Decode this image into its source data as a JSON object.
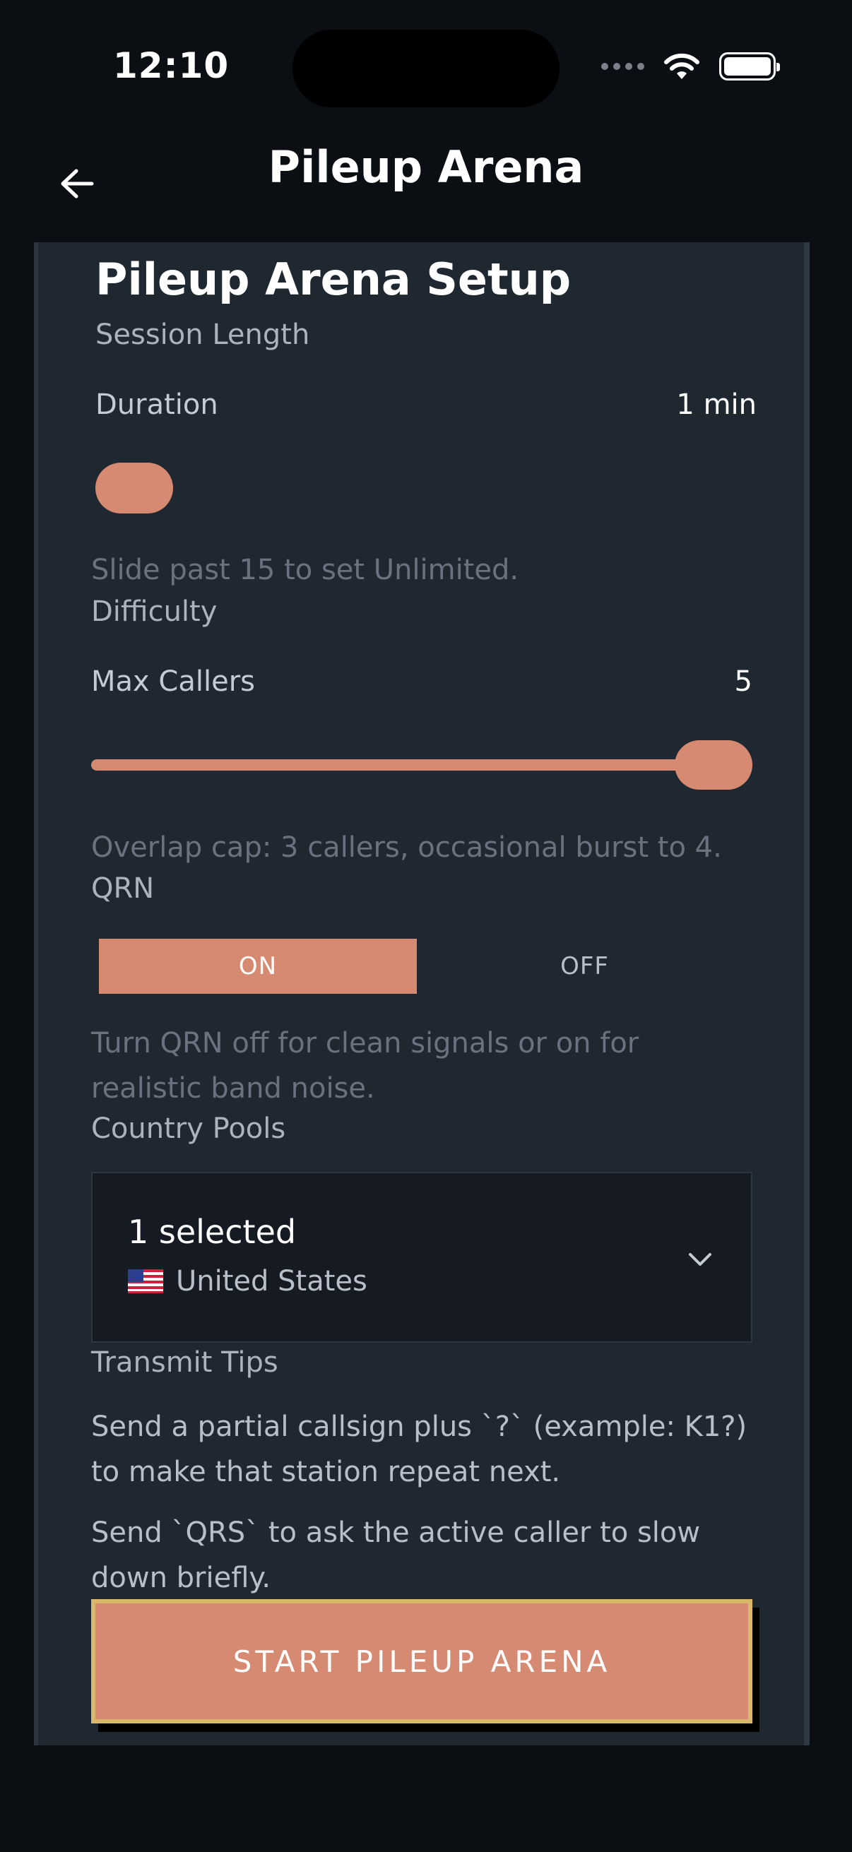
{
  "status": {
    "time": "12:10"
  },
  "app": {
    "title": "Pileup Arena"
  },
  "setup": {
    "heading": "Pileup Arena Setup",
    "session_length": {
      "section": "Session Length",
      "label": "Duration",
      "value": "1 min",
      "slider_fraction": 0.0,
      "hint": "Slide past 15 to set Unlimited."
    },
    "difficulty": {
      "section": "Difficulty",
      "label": "Max Callers",
      "value": "5",
      "slider_fraction": 1.0,
      "hint": "Overlap cap: 3 callers, occasional burst to 4."
    },
    "qrn": {
      "section": "QRN",
      "on_label": "ON",
      "off_label": "OFF",
      "selected": "ON",
      "hint": "Turn QRN off for clean signals or on for realistic band noise."
    },
    "country_pools": {
      "section": "Country Pools",
      "selected_count": "1 selected",
      "selected_country": "United States",
      "flag_icon": "us-flag-icon"
    },
    "transmit_tips": {
      "section": "Transmit Tips",
      "tip1": "Send a partial callsign plus `?` (example: K1?) to make that station repeat next.",
      "tip2": "Send `QRS` to ask the active caller to slow down briefly."
    },
    "start_label": "START PILEUP ARENA"
  },
  "colors": {
    "background": "#0b0e13",
    "card": "#1f2731",
    "accent": "#d78a72",
    "button_border": "#d8b96c"
  }
}
